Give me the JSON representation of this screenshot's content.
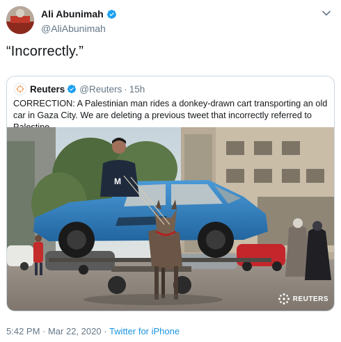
{
  "author": {
    "display_name": "Ali Abunimah",
    "handle": "@AliAbunimah",
    "verified": true
  },
  "tweet": {
    "text": "“Incorrectly.”"
  },
  "quoted_tweet": {
    "display_name": "Reuters",
    "handle": "@Reuters",
    "separator": "·",
    "time": "15h",
    "verified": true,
    "text": "CORRECTION: A Palestinian man rides a donkey-drawn cart transporting an old car in Gaza City. We are deleting a previous tweet that incorrectly referred to Palestine",
    "photo_watermark": "REUTERS"
  },
  "meta": {
    "timestamp": "5:42 PM · Mar 22, 2020",
    "separator": "·",
    "source": "Twitter for iPhone"
  },
  "colors": {
    "verified_badge": "#1da1f2",
    "link": "#1b95e0",
    "secondary_text": "#657786",
    "car_body": "#2e7fc4"
  }
}
